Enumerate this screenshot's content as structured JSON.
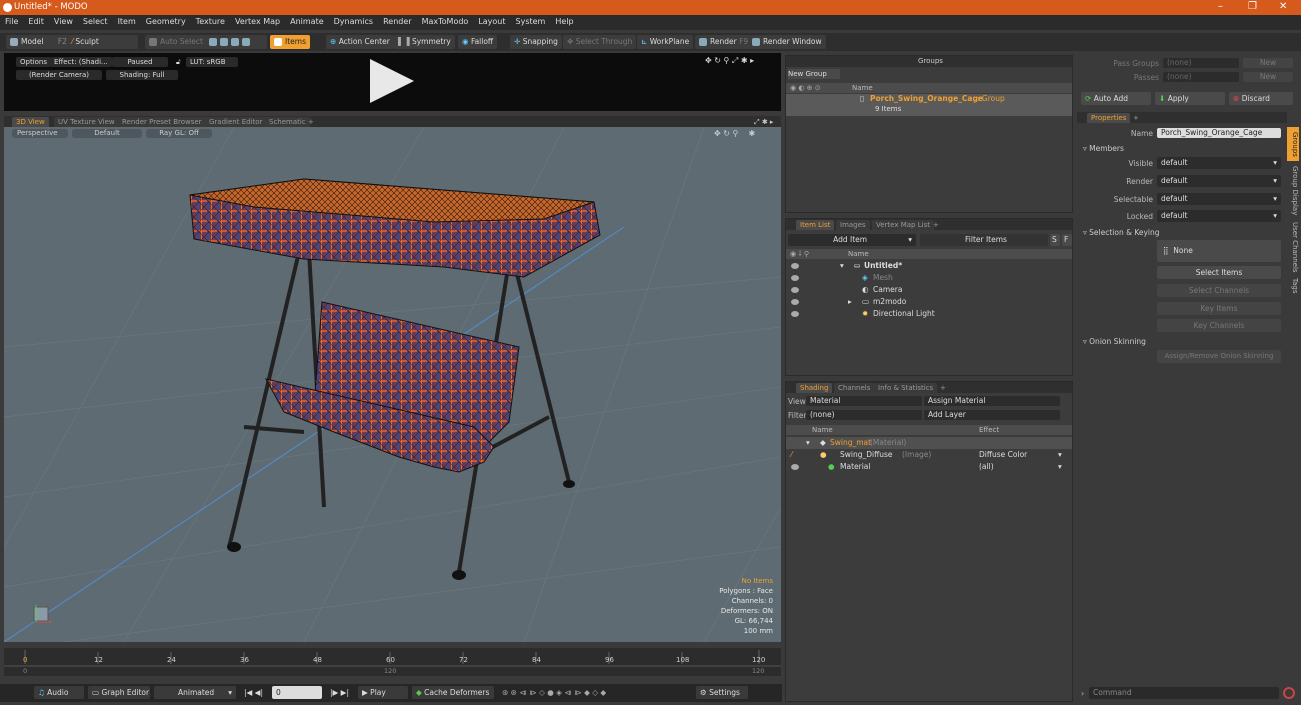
{
  "app": {
    "title": "Untitled* - MODO"
  },
  "menu": [
    "File",
    "Edit",
    "View",
    "Select",
    "Item",
    "Geometry",
    "Texture",
    "Vertex Map",
    "Animate",
    "Dynamics",
    "Render",
    "MaxToModo",
    "Layout",
    "System",
    "Help"
  ],
  "toolbar": {
    "model": "Model",
    "model_key": "F2",
    "sculpt": "Sculpt",
    "auto_select": "Auto Select",
    "items": "Items",
    "action_center": "Action Center",
    "symmetry": "Symmetry",
    "falloff": "Falloff",
    "snapping": "Snapping",
    "select_through": "Select Through",
    "workplane": "WorkPlane",
    "render": "Render",
    "render_key": "F9",
    "render_window": "Render Window"
  },
  "preview": {
    "options": "Options",
    "effect": "Effect: (Shadi...",
    "paused": "Paused",
    "lut": "LUT: sRGB",
    "camera": "(Render Camera)",
    "shading": "Shading: Full"
  },
  "viewport_tabs": [
    "3D View",
    "UV Texture View",
    "Render Preset Browser",
    "Gradient Editor",
    "Schematic",
    "+"
  ],
  "viewport": {
    "perspective": "Perspective",
    "default": "Default",
    "raygl": "Ray GL: Off",
    "info": [
      "No Items",
      "Polygons : Face",
      "Channels: 0",
      "Deformers: ON",
      "GL: 66,744",
      "100 mm"
    ]
  },
  "timeline": {
    "ticks": [
      "0",
      "12",
      "24",
      "36",
      "48",
      "60",
      "72",
      "84",
      "96",
      "108",
      "120"
    ],
    "sub_left": "0",
    "sub_mid": "120",
    "sub_right": "120"
  },
  "bottombar": {
    "audio": "Audio",
    "graph_editor": "Graph Editor",
    "animated": "Animated",
    "frame": "0",
    "play": "Play",
    "cache": "Cache Deformers",
    "settings": "Settings"
  },
  "groups": {
    "title": "Groups",
    "new_group": "New Group",
    "col_name": "Name",
    "item_name": "Porch_Swing_Orange_Cage",
    "item_suffix": ": Group",
    "item_count": "9 Items"
  },
  "itemlist": {
    "tabs": [
      "Item List",
      "Images",
      "Vertex Map List",
      "+"
    ],
    "add_item": "Add Item",
    "filter": "Filter Items",
    "s": "S",
    "f": "F",
    "col_name": "Name",
    "rows": [
      "Untitled*",
      "Mesh",
      "Camera",
      "m2modo",
      "Directional Light"
    ]
  },
  "shading": {
    "tabs": [
      "Shading",
      "Channels",
      "Info & Statistics",
      "+"
    ],
    "view_label": "View",
    "view_value": "Material",
    "assign": "Assign Material",
    "filter_label": "Filter",
    "filter_value": "(none)",
    "add_layer": "Add Layer",
    "col_name": "Name",
    "col_effect": "Effect",
    "rows": [
      {
        "name": "Swing_mat",
        "tag": "(Material)",
        "effect": ""
      },
      {
        "name": "Swing_Diffuse",
        "tag": "(Image)",
        "effect": "Diffuse Color"
      },
      {
        "name": "Material",
        "tag": "",
        "effect": "(all)"
      }
    ]
  },
  "right": {
    "pass_groups": "Pass Groups",
    "passes": "Passes",
    "none": "(none)",
    "new": "New",
    "auto_add": "Auto Add",
    "apply": "Apply",
    "discard": "Discard",
    "properties": "Properties",
    "plus": "+",
    "name_label": "Name",
    "name_value": "Porch_Swing_Orange_Cage",
    "members": "Members",
    "visible": "Visible",
    "render": "Render",
    "selectable": "Selectable",
    "locked": "Locked",
    "default": "default",
    "selection_keying": "Selection & Keying",
    "none_btn": "None",
    "select_items": "Select Items",
    "select_channels": "Select Channels",
    "key_items": "Key Items",
    "key_channels": "Key Channels",
    "onion": "Onion Skinning",
    "onion_btn": "Assign/Remove Onion Skinning",
    "side_tabs": [
      "Groups",
      "Group Display",
      "User Channels",
      "Tags"
    ],
    "command": "Command"
  },
  "colors": {
    "accent": "#f0a030",
    "titlebar": "#d65a1c",
    "viewport": "#5e6b72"
  }
}
